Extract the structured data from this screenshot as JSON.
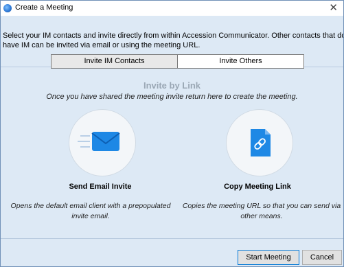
{
  "window": {
    "title": "Create a Meeting",
    "close_glyph": "✕"
  },
  "description": "Select your IM contacts and invite directly from within Accession Communicator.  Other contacts that do not have IM can be invited via email or using the meeting URL.",
  "tabs": [
    {
      "label": "Invite IM Contacts",
      "active": false
    },
    {
      "label": "Invite Others",
      "active": true
    }
  ],
  "invite_by_link": {
    "heading": "Invite by Link",
    "subtitle": "Once you have shared the meeting invite return here to create the meeting."
  },
  "actions": [
    {
      "label": "Send Email Invite",
      "icon": "envelope-icon",
      "description": "Opens the default email client with a prepopulated invite email."
    },
    {
      "label": "Copy Meeting Link",
      "icon": "link-document-icon",
      "description": "Copies the meeting URL so that you can send via other means."
    }
  ],
  "buttons": {
    "start": "Start Meeting",
    "cancel": "Cancel"
  },
  "colors": {
    "accent": "#1e88e5",
    "window_bg": "#dde9f5",
    "heading": "#9aa7b4"
  }
}
